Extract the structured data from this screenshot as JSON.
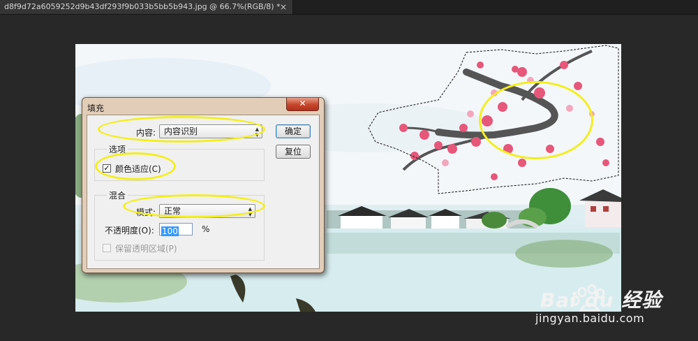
{
  "tab": {
    "title": "d8f9d72a6059252d9b43df293f9b033b5bb5b943.jpg @ 66.7%(RGB/8) *",
    "close_glyph": "×"
  },
  "dialog": {
    "title": "填充",
    "close_glyph": "✕",
    "content_label": "内容:",
    "content_value": "内容识别",
    "ok_label": "确定",
    "reset_label": "复位",
    "options_group": "选项",
    "color_adapt_label": "颜色适应(C)",
    "color_adapt_checked": true,
    "blend_group": "混合",
    "mode_label": "模式:",
    "mode_value": "正常",
    "opacity_label": "不透明度(O):",
    "opacity_value": "100",
    "opacity_unit": "%",
    "preserve_label": "保留透明区域(P)",
    "preserve_checked": false
  },
  "watermark": {
    "brand": "Bai du 经验",
    "url": "jingyan.baidu.com"
  },
  "colors": {
    "app_bg": "#282828",
    "annotation": "#f4ee1a",
    "dialog_frame": "#e2cdb8",
    "close_button": "#c5452a"
  }
}
